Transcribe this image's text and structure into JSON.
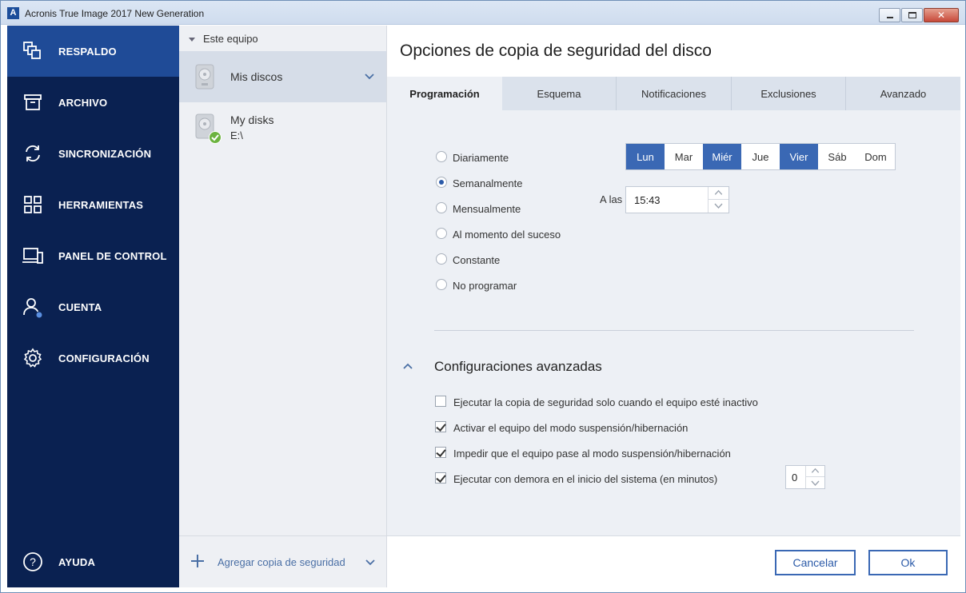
{
  "window": {
    "title": "Acronis True Image 2017 New Generation",
    "logo_letter": "A",
    "close_glyph": "✕"
  },
  "nav": {
    "items": [
      {
        "label": "RESPALDO",
        "icon": "backup-icon",
        "active": true
      },
      {
        "label": "ARCHIVO",
        "icon": "archive-icon"
      },
      {
        "label": "SINCRONIZACIÓN",
        "icon": "sync-icon"
      },
      {
        "label": "HERRAMIENTAS",
        "icon": "tools-grid-icon"
      },
      {
        "label": "PANEL DE CONTROL",
        "icon": "dashboard-icon"
      },
      {
        "label": "CUENTA",
        "icon": "account-icon"
      },
      {
        "label": "CONFIGURACIÓN",
        "icon": "gear-icon"
      }
    ],
    "help_label": "AYUDA",
    "help_glyph": "?"
  },
  "sources": {
    "header": "Este equipo",
    "items": [
      {
        "title": "Mis discos",
        "selected": true
      },
      {
        "title": "My disks",
        "subtitle": "E:\\"
      }
    ],
    "add_label": "Agregar copia de seguridad"
  },
  "panel": {
    "title": "Opciones de copia de seguridad del disco",
    "tabs": [
      "Programación",
      "Esquema",
      "Notificaciones",
      "Exclusiones",
      "Avanzado"
    ],
    "schedule": {
      "options": [
        "Diariamente",
        "Semanalmente",
        "Mensualmente",
        "Al momento del suceso",
        "Constante",
        "No programar"
      ],
      "selected": "Semanalmente",
      "days": [
        {
          "label": "Lun",
          "on": true
        },
        {
          "label": "Mar",
          "on": false
        },
        {
          "label": "Miér",
          "on": true
        },
        {
          "label": "Jue",
          "on": false
        },
        {
          "label": "Vier",
          "on": true
        },
        {
          "label": "Sáb",
          "on": false
        },
        {
          "label": "Dom",
          "on": false
        }
      ],
      "time_label": "A las",
      "time_value": "15:43"
    },
    "advanced": {
      "title": "Configuraciones avanzadas",
      "options": [
        {
          "label": "Ejecutar la copia de seguridad solo cuando el equipo esté inactivo",
          "checked": false
        },
        {
          "label": "Activar el equipo del modo suspensión/hibernación",
          "checked": true
        },
        {
          "label": "Impedir que el equipo pase al modo suspensión/hibernación",
          "checked": true
        },
        {
          "label": "Ejecutar con demora en el inicio del sistema (en minutos)",
          "checked": true
        }
      ],
      "delay_value": "0"
    },
    "buttons": {
      "cancel": "Cancelar",
      "ok": "Ok"
    }
  },
  "colors": {
    "nav_bg": "#0a2151",
    "nav_active": "#1f4b97",
    "accent": "#3a68b4",
    "success": "#6cb33f"
  }
}
